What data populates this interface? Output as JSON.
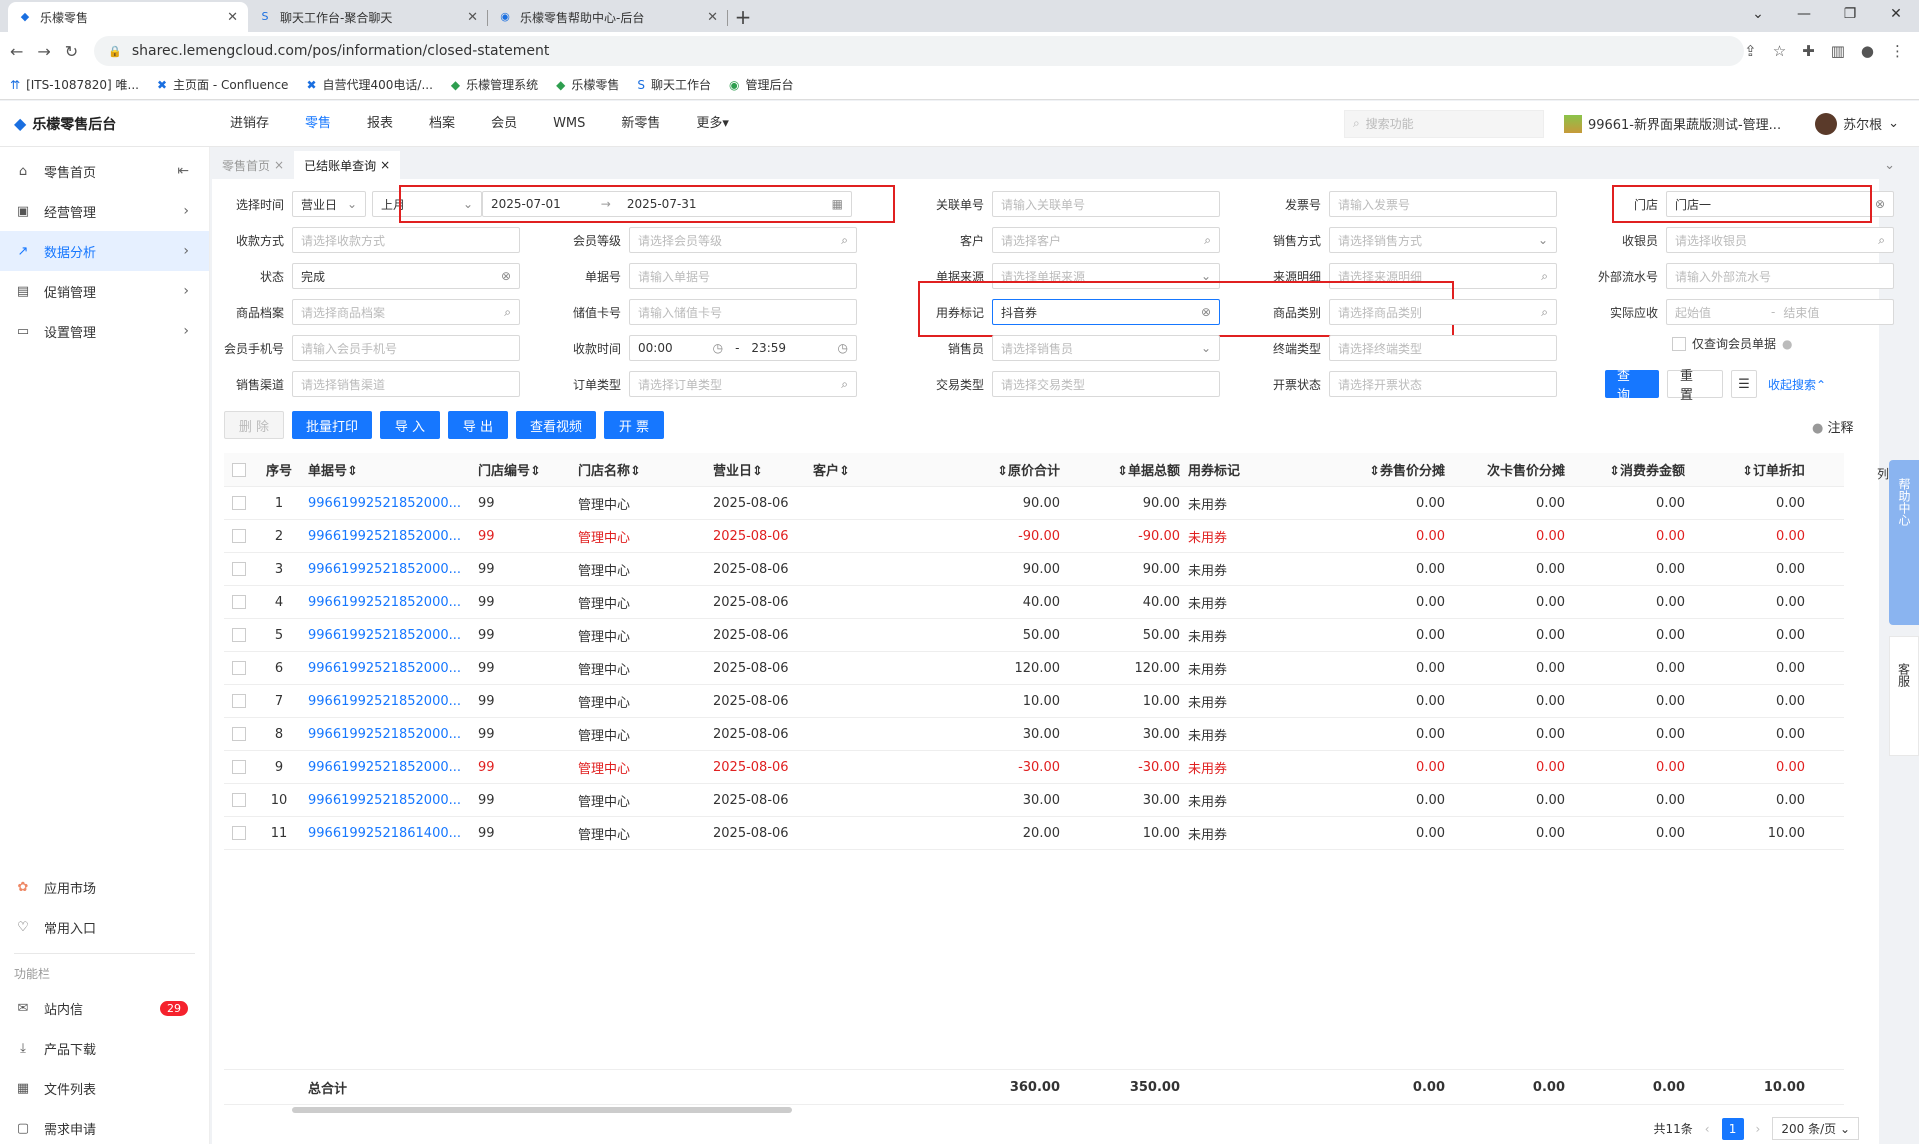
{
  "browser": {
    "tabs": [
      {
        "title": "乐檬零售",
        "active": true
      },
      {
        "title": "聊天工作台-聚合聊天",
        "active": false
      },
      {
        "title": "乐檬零售帮助中心-后台",
        "active": false
      }
    ],
    "url": "sharec.lemengcloud.com/pos/information/closed-statement",
    "bookmarks": [
      "[ITS-1087820] 唯...",
      "主页面 - Confluence",
      "自营代理400电话/...",
      "乐檬管理系统",
      "乐檬零售",
      "聊天工作台",
      "管理后台"
    ]
  },
  "header": {
    "logo": "乐檬零售后台",
    "nav": [
      "进销存",
      "零售",
      "报表",
      "档案",
      "会员",
      "WMS",
      "新零售",
      "更多▾"
    ],
    "active_nav": 1,
    "search_placeholder": "搜索功能",
    "store": "99661-新界面果蔬版测试-管理...",
    "user": "苏尔根"
  },
  "sidebar": {
    "items": [
      {
        "label": "零售首页",
        "icon": "home"
      },
      {
        "label": "经营管理",
        "icon": "monitor"
      },
      {
        "label": "数据分析",
        "icon": "chart",
        "active": true
      },
      {
        "label": "促销管理",
        "icon": "promo"
      },
      {
        "label": "设置管理",
        "icon": "settings"
      }
    ],
    "bottom": [
      {
        "label": "应用市场"
      },
      {
        "label": "常用入口"
      }
    ],
    "section": "功能栏",
    "tools": [
      {
        "label": "站内信",
        "badge": "29"
      },
      {
        "label": "产品下载"
      },
      {
        "label": "文件列表"
      },
      {
        "label": "需求申请"
      }
    ]
  },
  "pagetabs": [
    {
      "label": "零售首页",
      "active": false
    },
    {
      "label": "已结账单查询",
      "active": true
    }
  ],
  "filters": {
    "date_label": "选择时间",
    "date_type": "营业日",
    "period": "上月",
    "start": "2025-07-01",
    "end": "2025-07-31",
    "rel_label": "关联单号",
    "rel_ph": "请输入关联单号",
    "inv_label": "发票号",
    "inv_ph": "请输入发票号",
    "store_label": "门店",
    "store_val": "门店一",
    "pay_label": "收款方式",
    "pay_ph": "请选择收款方式",
    "lvl_label": "会员等级",
    "lvl_ph": "请选择会员等级",
    "cust_label": "客户",
    "cust_ph": "请选择客户",
    "sale_label": "销售方式",
    "sale_ph": "请选择销售方式",
    "cashier_label": "收银员",
    "cashier_ph": "请选择收银员",
    "status_label": "状态",
    "status_val": "完成",
    "doc_label": "单据号",
    "doc_ph": "请输入单据号",
    "src_label": "单据来源",
    "src_ph": "请选择单据来源",
    "srcd_label": "来源明细",
    "srcd_ph": "请选择来源明细",
    "ext_label": "外部流水号",
    "ext_ph": "请输入外部流水号",
    "goods_label": "商品档案",
    "goods_ph": "请选择商品档案",
    "card_label": "储值卡号",
    "card_ph": "请输入储值卡号",
    "coupon_label": "用券标记",
    "coupon_val": "抖音券",
    "cat_label": "商品类别",
    "cat_ph": "请选择商品类别",
    "recv_label": "实际应收",
    "recv_min": "起始值",
    "recv_max": "结束值",
    "phone_label": "会员手机号",
    "phone_ph": "请输入会员手机号",
    "time_label": "收款时间",
    "time_start": "00:00",
    "time_end": "23:59",
    "seller_label": "销售员",
    "seller_ph": "请选择销售员",
    "term_label": "终端类型",
    "term_ph": "请选择终端类型",
    "member_only": "仅查询会员单据",
    "chan_label": "销售渠道",
    "chan_ph": "请选择销售渠道",
    "ord_label": "订单类型",
    "ord_ph": "请选择订单类型",
    "trade_label": "交易类型",
    "trade_ph": "请选择交易类型",
    "bill_label": "开票状态",
    "bill_ph": "请选择开票状态",
    "query": "查 询",
    "reset": "重 置",
    "collapse": "收起搜索"
  },
  "actions": [
    "删 除",
    "批量打印",
    "导 入",
    "导 出",
    "查看视频",
    "开 票"
  ],
  "note": "注释",
  "table": {
    "headers": [
      "序号",
      "单据号",
      "门店编号",
      "门店名称",
      "营业日",
      "客户",
      "原价合计",
      "单据总额",
      "用券标记",
      "券售价分摊",
      "次卡售价分摊",
      "消费券金额",
      "订单折扣"
    ],
    "rows": [
      {
        "n": "1",
        "doc": "99661992521852000...",
        "code": "99",
        "store": "管理中心",
        "day": "2025-08-06",
        "cust": "",
        "orig": "90.00",
        "total": "90.00",
        "coupon": "未用券",
        "a": "0.00",
        "b": "0.00",
        "c": "0.00",
        "d": "0.00",
        "red": false
      },
      {
        "n": "2",
        "doc": "99661992521852000...",
        "code": "99",
        "store": "管理中心",
        "day": "2025-08-06",
        "cust": "",
        "orig": "-90.00",
        "total": "-90.00",
        "coupon": "未用券",
        "a": "0.00",
        "b": "0.00",
        "c": "0.00",
        "d": "0.00",
        "red": true
      },
      {
        "n": "3",
        "doc": "99661992521852000...",
        "code": "99",
        "store": "管理中心",
        "day": "2025-08-06",
        "cust": "",
        "orig": "90.00",
        "total": "90.00",
        "coupon": "未用券",
        "a": "0.00",
        "b": "0.00",
        "c": "0.00",
        "d": "0.00",
        "red": false
      },
      {
        "n": "4",
        "doc": "99661992521852000...",
        "code": "99",
        "store": "管理中心",
        "day": "2025-08-06",
        "cust": "",
        "orig": "40.00",
        "total": "40.00",
        "coupon": "未用券",
        "a": "0.00",
        "b": "0.00",
        "c": "0.00",
        "d": "0.00",
        "red": false
      },
      {
        "n": "5",
        "doc": "99661992521852000...",
        "code": "99",
        "store": "管理中心",
        "day": "2025-08-06",
        "cust": "",
        "orig": "50.00",
        "total": "50.00",
        "coupon": "未用券",
        "a": "0.00",
        "b": "0.00",
        "c": "0.00",
        "d": "0.00",
        "red": false
      },
      {
        "n": "6",
        "doc": "99661992521852000...",
        "code": "99",
        "store": "管理中心",
        "day": "2025-08-06",
        "cust": "",
        "orig": "120.00",
        "total": "120.00",
        "coupon": "未用券",
        "a": "0.00",
        "b": "0.00",
        "c": "0.00",
        "d": "0.00",
        "red": false
      },
      {
        "n": "7",
        "doc": "99661992521852000...",
        "code": "99",
        "store": "管理中心",
        "day": "2025-08-06",
        "cust": "",
        "orig": "10.00",
        "total": "10.00",
        "coupon": "未用券",
        "a": "0.00",
        "b": "0.00",
        "c": "0.00",
        "d": "0.00",
        "red": false
      },
      {
        "n": "8",
        "doc": "99661992521852000...",
        "code": "99",
        "store": "管理中心",
        "day": "2025-08-06",
        "cust": "",
        "orig": "30.00",
        "total": "30.00",
        "coupon": "未用券",
        "a": "0.00",
        "b": "0.00",
        "c": "0.00",
        "d": "0.00",
        "red": false
      },
      {
        "n": "9",
        "doc": "99661992521852000...",
        "code": "99",
        "store": "管理中心",
        "day": "2025-08-06",
        "cust": "",
        "orig": "-30.00",
        "total": "-30.00",
        "coupon": "未用券",
        "a": "0.00",
        "b": "0.00",
        "c": "0.00",
        "d": "0.00",
        "red": true
      },
      {
        "n": "10",
        "doc": "99661992521852000...",
        "code": "99",
        "store": "管理中心",
        "day": "2025-08-06",
        "cust": "",
        "orig": "30.00",
        "total": "30.00",
        "coupon": "未用券",
        "a": "0.00",
        "b": "0.00",
        "c": "0.00",
        "d": "0.00",
        "red": false
      },
      {
        "n": "11",
        "doc": "99661992521861400...",
        "code": "99",
        "store": "管理中心",
        "day": "2025-08-06",
        "cust": "",
        "orig": "20.00",
        "total": "10.00",
        "coupon": "未用券",
        "a": "0.00",
        "b": "0.00",
        "c": "0.00",
        "d": "10.00",
        "red": false
      }
    ],
    "total_label": "总合计",
    "total_orig": "360.00",
    "total_total": "350.00",
    "total_a": "0.00",
    "total_b": "0.00",
    "total_c": "0.00",
    "total_d": "10.00"
  },
  "pager": {
    "count": "共11条",
    "page": "1",
    "size": "200 条/页"
  },
  "rightbar": {
    "help": "帮助中心",
    "service": "客服",
    "cols": "列"
  }
}
